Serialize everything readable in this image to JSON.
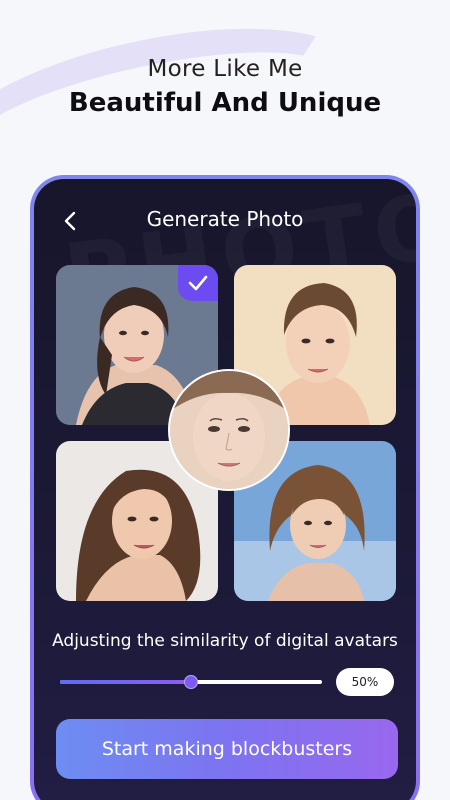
{
  "header": {
    "subtitle": "More Like Me",
    "title": "Beautiful And Unique"
  },
  "screen": {
    "title": "Generate Photo",
    "watermark": "PHOTO",
    "back_icon": "chevron-left-icon",
    "selected_icon": "checkmark-icon"
  },
  "photos": [
    {
      "name": "photo-1",
      "selected": true
    },
    {
      "name": "photo-2",
      "selected": false
    },
    {
      "name": "photo-3",
      "selected": false
    },
    {
      "name": "photo-4",
      "selected": false
    }
  ],
  "similarity": {
    "label": "Adjusting the similarity of digital avatars",
    "value": 50,
    "value_label": "50%"
  },
  "cta": {
    "label": "Start making blockbusters"
  },
  "colors": {
    "accent": "#6c4cf0",
    "screen_bg": "#17162b",
    "frame": "#7f86ee"
  }
}
